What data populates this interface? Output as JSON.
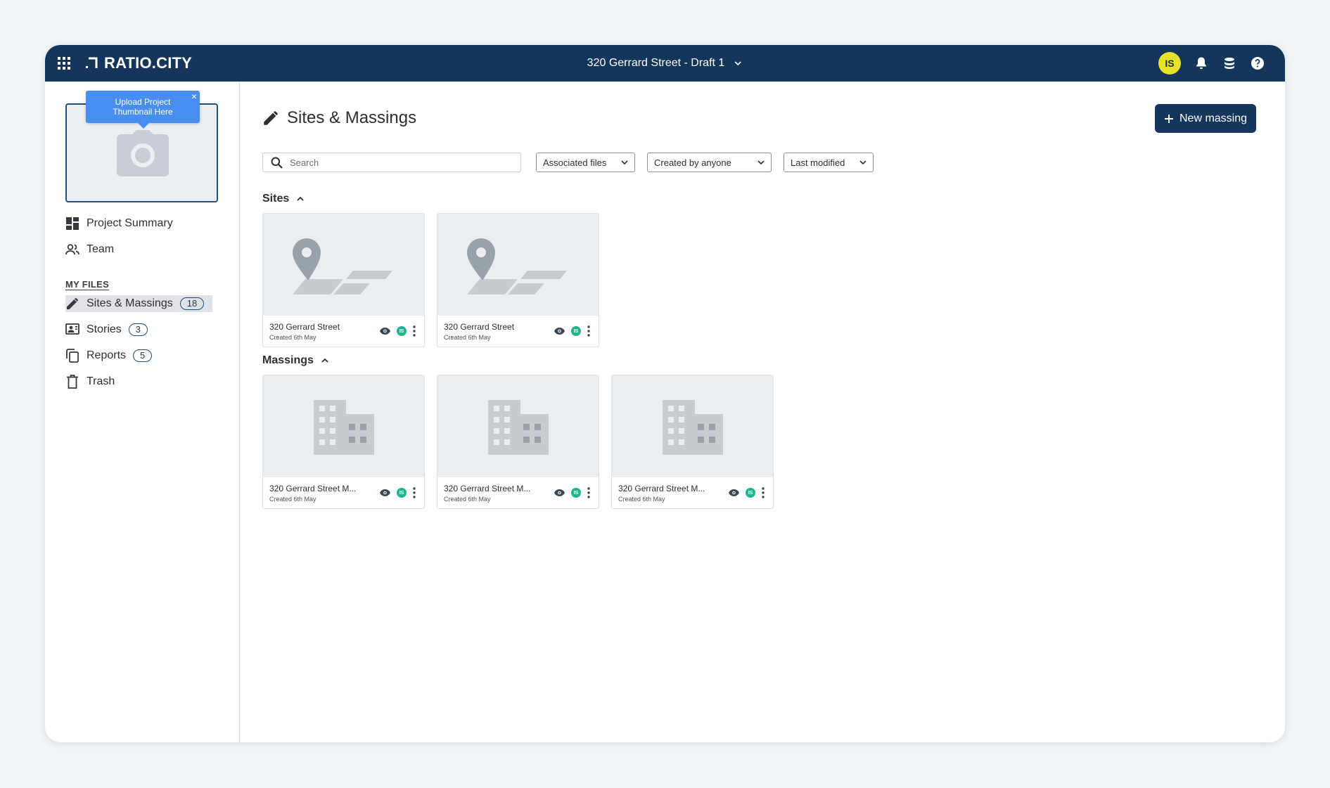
{
  "app": {
    "brand": "RATIO.CITY",
    "project_title": "320 Gerrard Street - Draft 1",
    "user_initials": "IS"
  },
  "colors": {
    "topbar": "#13365a",
    "avatar": "#e6e22a",
    "tooltip": "#4a8df0",
    "owner_avatar": "#1fb58c"
  },
  "icons": {
    "apps": "apps-grid-icon",
    "notifications": "bell-icon",
    "data": "database-icon",
    "help": "help-icon"
  },
  "sidebar": {
    "tooltip": {
      "line1": "Upload Project",
      "line2": "Thumbnail Here",
      "close": "×"
    },
    "nav": [
      {
        "label": "Project Summary",
        "icon": "dashboard-icon"
      },
      {
        "label": "Team",
        "icon": "team-icon"
      }
    ],
    "section_label": "MY FILES",
    "files": [
      {
        "label": "Sites & Massings",
        "count": "18",
        "icon": "pencil-icon",
        "active": true
      },
      {
        "label": "Stories",
        "count": "3",
        "icon": "stories-icon"
      },
      {
        "label": "Reports",
        "count": "5",
        "icon": "copy-icon"
      },
      {
        "label": "Trash",
        "icon": "trash-icon"
      }
    ]
  },
  "main": {
    "title": "Sites & Massings",
    "new_button": "New massing",
    "search_placeholder": "Search",
    "filters": [
      "Associated files",
      "Created by anyone",
      "Last modified"
    ],
    "sites_heading": "Sites",
    "massings_heading": "Massings",
    "sites": [
      {
        "title": "320 Gerrard Street",
        "created": "Created 6th May",
        "owner": "IS"
      },
      {
        "title": "320 Gerrard Street",
        "created": "Created 6th May",
        "owner": "IS"
      }
    ],
    "massings": [
      {
        "title": "320 Gerrard Street M...",
        "created": "Created 6th May",
        "owner": "IS"
      },
      {
        "title": "320 Gerrard Street M...",
        "created": "Created 6th May",
        "owner": "IS"
      },
      {
        "title": "320 Gerrard Street M...",
        "created": "Created 6th May",
        "owner": "IS"
      }
    ]
  }
}
